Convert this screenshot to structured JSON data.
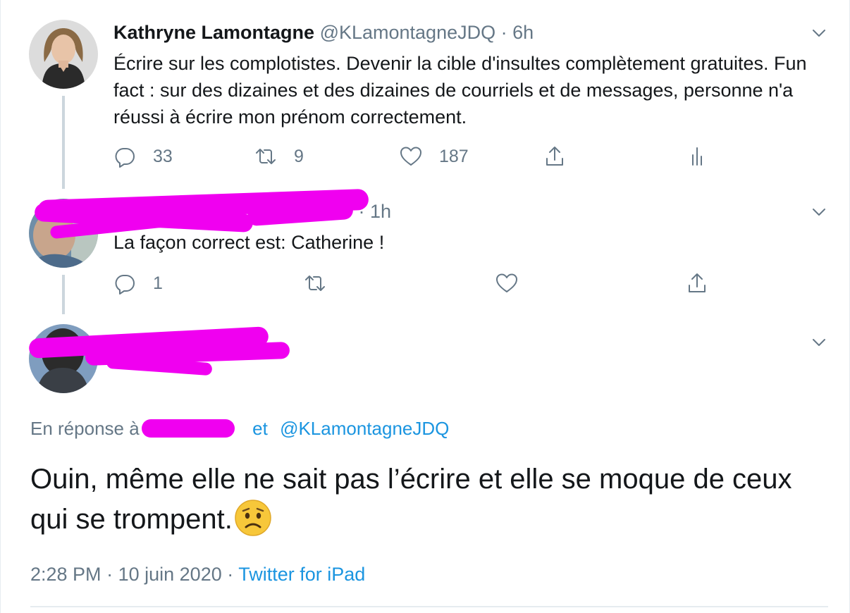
{
  "tweet1": {
    "name": "Kathryne Lamontagne",
    "handle": "@KLamontagneJDQ",
    "dot": "·",
    "time": "6h",
    "text": "Écrire sur les complotistes. Devenir la cible d'insultes complètement gratuites. Fun fact : sur des dizaines et des dizaines de courriels et de messages, personne n'a réussi à écrire mon prénom correctement.",
    "replies": "33",
    "retweets": "9",
    "likes": "187"
  },
  "tweet2": {
    "dot": "·",
    "time": "1h",
    "text": "La façon correct est:  Catherine !",
    "replies": "1"
  },
  "main_tweet": {
    "reply_prefix": "En réponse à",
    "reply_and": "et",
    "reply_mention": "@KLamontagneJDQ",
    "text": "Ouin, même elle ne sait pas l’écrire et elle se moque de ceux qui se trompent.",
    "emoji": "worried-face-emoji",
    "time": "2:28 PM",
    "dot1": "·",
    "date": "10 juin 2020",
    "dot2": "·",
    "source": "Twitter for iPad"
  },
  "icons": {
    "reply": "reply-icon",
    "retweet": "retweet-icon",
    "like": "heart-icon",
    "share": "share-icon",
    "analytics": "analytics-icon",
    "menu": "chevron-down-icon"
  },
  "colors": {
    "link": "#1b95e0",
    "secondary_text": "#657786",
    "primary_text": "#14171a",
    "redaction": "#f000f0",
    "thread_line": "#ccd6dd"
  }
}
